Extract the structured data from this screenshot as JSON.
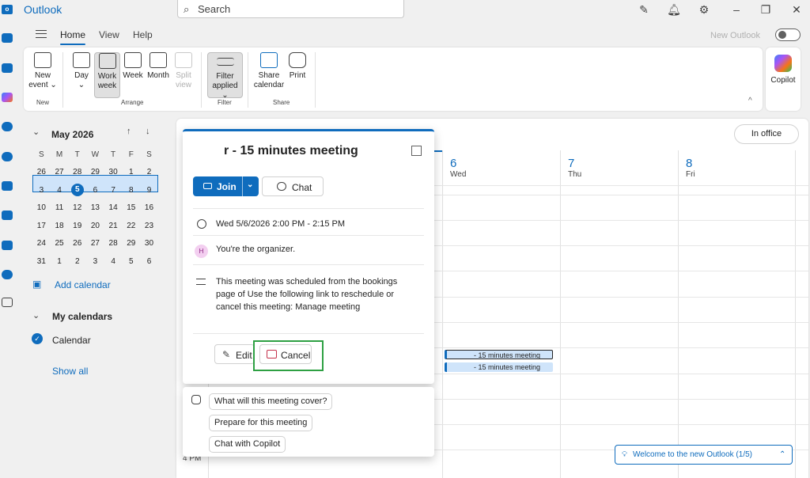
{
  "app": {
    "title": "Outlook",
    "logo_text": "o"
  },
  "search": {
    "placeholder": "Search"
  },
  "titlebar_icons": [
    "feedback-icon",
    "bell-icon",
    "gear-icon",
    "minimize-icon",
    "restore-icon",
    "close-icon"
  ],
  "ribbon_tabs": [
    "Home",
    "View",
    "Help"
  ],
  "new_outlook": {
    "label": "New Outlook"
  },
  "ribbon": {
    "new_event": {
      "line1": "New",
      "line2": "event ⌄"
    },
    "day": {
      "line1": "Day",
      "line2": "⌄"
    },
    "work_week": {
      "line1": "Work",
      "line2": "week"
    },
    "week": "Week",
    "month": "Month",
    "split_view": {
      "line1": "Split",
      "line2": "view"
    },
    "filter": {
      "line1": "Filter",
      "line2": "applied ⌄"
    },
    "share_calendar": {
      "line1": "Share",
      "line2": "calendar"
    },
    "print": "Print",
    "groups": {
      "new": "New",
      "arrange": "Arrange",
      "filter": "Filter",
      "share": "Share"
    },
    "collapse": "^"
  },
  "copilot": {
    "label": "Copilot"
  },
  "mini_calendar": {
    "title": "May 2026",
    "weekdays": [
      "S",
      "M",
      "T",
      "W",
      "T",
      "F",
      "S"
    ],
    "weeks": [
      [
        "26",
        "27",
        "28",
        "29",
        "30",
        "1",
        "2"
      ],
      [
        "3",
        "4",
        "5",
        "6",
        "7",
        "8",
        "9"
      ],
      [
        "10",
        "11",
        "12",
        "13",
        "14",
        "15",
        "16"
      ],
      [
        "17",
        "18",
        "19",
        "20",
        "21",
        "22",
        "23"
      ],
      [
        "24",
        "25",
        "26",
        "27",
        "28",
        "29",
        "30"
      ],
      [
        "31",
        "1",
        "2",
        "3",
        "4",
        "5",
        "6"
      ]
    ],
    "today": "5"
  },
  "nav": {
    "add_calendar": "Add calendar",
    "my_calendars": "My calendars",
    "calendar_item": "Calendar",
    "show_all": "Show all"
  },
  "calendar_view": {
    "in_office": "In office",
    "days": [
      {
        "num": "6",
        "name": "Wed"
      },
      {
        "num": "7",
        "name": "Thu"
      },
      {
        "num": "8",
        "name": "Fri"
      }
    ],
    "hour_label": "4 PM",
    "events": [
      "- 15 minutes meeting",
      "- 15 minutes meeting"
    ],
    "welcome": "Welcome to the new Outlook  (1/5)"
  },
  "event_card": {
    "title": "r - 15 minutes meeting",
    "join": "Join",
    "chat": "Chat",
    "datetime": "Wed 5/6/2026 2:00 PM - 2:15 PM",
    "organizer_initial": "H",
    "organizer": "You're the organizer.",
    "description": "This meeting was scheduled from the bookings page of            Use the following link to reschedule or cancel this meeting: Manage meeting",
    "edit": "Edit",
    "cancel": "Cancel"
  },
  "copilot_suggestions": [
    "What will this meeting cover?",
    "Prepare for this meeting",
    "Chat with Copilot"
  ]
}
